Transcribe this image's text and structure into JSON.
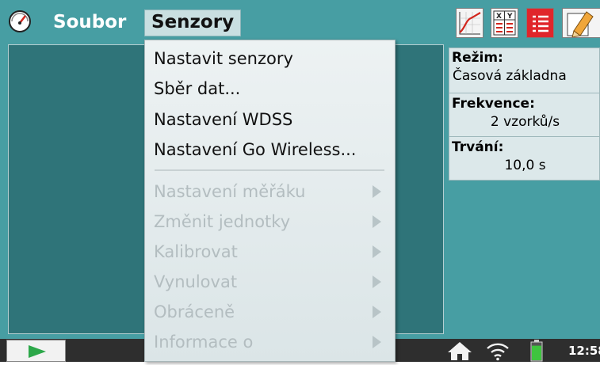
{
  "menubar": {
    "file_menu": "Soubor",
    "sensors_menu": "Senzory"
  },
  "toolbar": {
    "icons": [
      "graph-icon",
      "table-icon",
      "list-icon",
      "notes-icon"
    ]
  },
  "dropdown": {
    "items": [
      {
        "label": "Nastavit senzory",
        "enabled": true
      },
      {
        "label": "Sběr dat...",
        "enabled": true
      },
      {
        "label": "Nastavení WDSS",
        "enabled": true
      },
      {
        "label": "Nastavení Go Wireless...",
        "enabled": true
      },
      {
        "label": "Nastavení měřáku",
        "enabled": false,
        "submenu": true
      },
      {
        "label": "Změnit jednotky",
        "enabled": false,
        "submenu": true
      },
      {
        "label": "Kalibrovat",
        "enabled": false,
        "submenu": true
      },
      {
        "label": "Vynulovat",
        "enabled": false,
        "submenu": true
      },
      {
        "label": "Obráceně",
        "enabled": false,
        "submenu": true
      },
      {
        "label": "Informace o",
        "enabled": false,
        "submenu": true
      }
    ]
  },
  "info_panel": {
    "mode_label": "Režim:",
    "mode_value": "Časová základna",
    "rate_label": "Frekvence:",
    "rate_value": "2 vzorků/s",
    "duration_label": "Trvání:",
    "duration_value": "10,0 s"
  },
  "taskbar": {
    "clock": "12:58",
    "battery_level": 0.8,
    "colors": {
      "battery": "#3ec43e",
      "play": "#2da84a"
    }
  }
}
